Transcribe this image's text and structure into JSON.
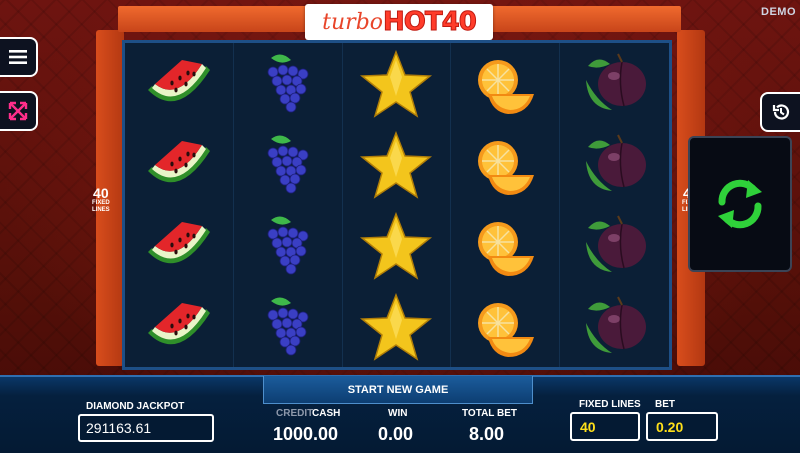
{
  "header": {
    "logo_turbo": "turbo",
    "logo_hot": "HOT40",
    "demo": "DEMO"
  },
  "side": {
    "lines_num": "40",
    "lines_text_1": "FIXED",
    "lines_text_2": "LINES"
  },
  "reels": [
    [
      "watermelon",
      "watermelon",
      "watermelon",
      "watermelon"
    ],
    [
      "grapes",
      "grapes",
      "grapes",
      "grapes"
    ],
    [
      "star",
      "star",
      "star",
      "star"
    ],
    [
      "orange",
      "orange",
      "orange",
      "orange"
    ],
    [
      "plum",
      "plum",
      "plum",
      "plum"
    ]
  ],
  "icons": {
    "menu": "hamburger-menu-icon",
    "expand": "fullscreen-icon",
    "history": "history-icon",
    "spin": "spin-arrows-icon"
  },
  "colors": {
    "spin_green": "#2fd13a",
    "value_yellow": "#ffe01a",
    "frame_orange": "#d84d1c"
  },
  "bottom": {
    "start_new_game": "START NEW GAME",
    "jackpot_label": "DIAMOND JACKPOT",
    "jackpot_value": "291163.61",
    "credit_label": "CREDIT",
    "cash_label": "CASH",
    "credit_value": "1000.00",
    "win_label": "WIN",
    "win_value": "0.00",
    "total_bet_label": "TOTAL BET",
    "total_bet_value": "8.00",
    "fixed_lines_label": "FIXED LINES",
    "fixed_lines_value": "40",
    "bet_label": "BET",
    "bet_value": "0.20"
  }
}
